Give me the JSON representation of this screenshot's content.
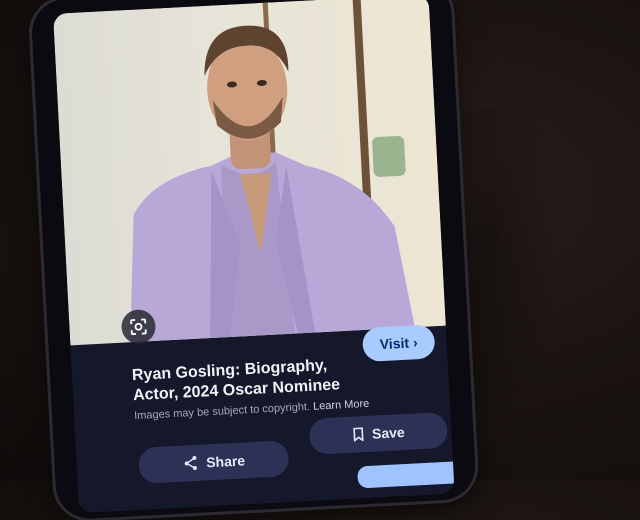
{
  "result": {
    "title": "Ryan Gosling: Biography, Actor, 2024 Oscar Nominee",
    "copyright": "Images may be subject to copyright.",
    "learn_more": "Learn More"
  },
  "actions": {
    "visit_label": "Visit",
    "share_label": "Share",
    "save_label": "Save"
  },
  "icons": {
    "lens": "lens-search-icon",
    "chevron": "chevron-right-icon",
    "share": "share-icon",
    "bookmark": "bookmark-icon"
  },
  "colors": {
    "visit_button": "#a9ccff",
    "pill_button": "#2d3156",
    "panel": "#15172a"
  }
}
